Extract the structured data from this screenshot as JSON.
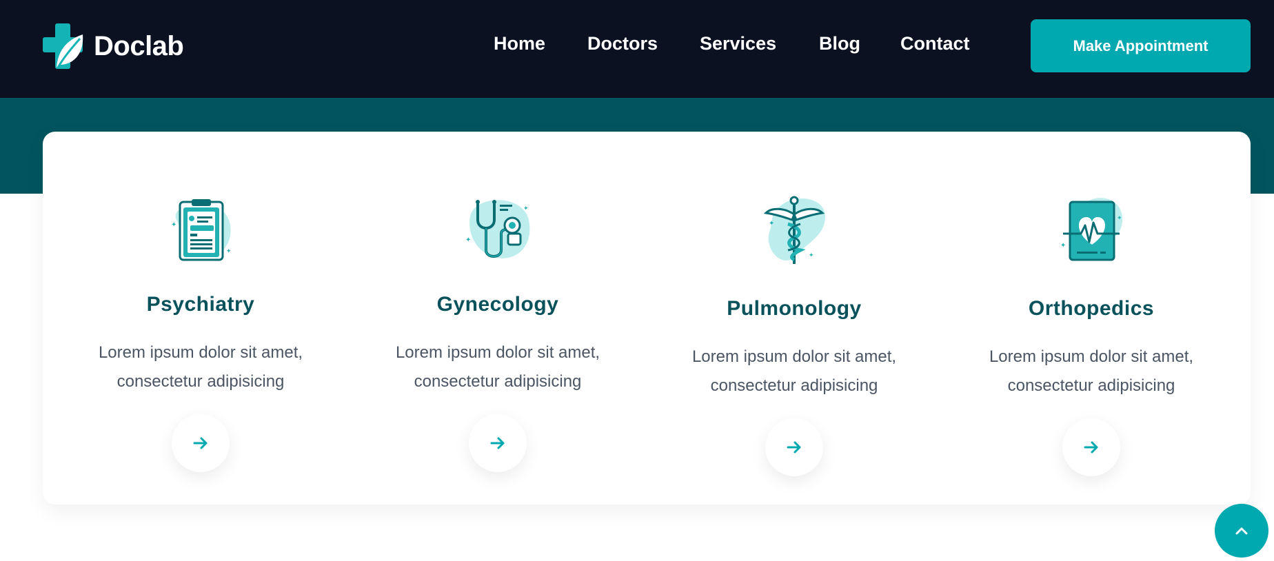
{
  "brand": {
    "name": "Doclab",
    "logo_icon": "cross-leaf-logo-icon"
  },
  "nav": {
    "items": [
      {
        "label": "Home"
      },
      {
        "label": "Doctors"
      },
      {
        "label": "Services"
      },
      {
        "label": "Blog"
      },
      {
        "label": "Contact"
      }
    ],
    "cta_label": "Make Appointment"
  },
  "services": [
    {
      "title": "Psychiatry",
      "desc_line1": "Lorem ipsum dolor sit amet,",
      "desc_line2": "consectetur adipisicing",
      "icon": "clipboard-icon"
    },
    {
      "title": "Gynecology",
      "desc_line1": "Lorem ipsum dolor sit amet,",
      "desc_line2": "consectetur adipisicing",
      "icon": "stethoscope-icon"
    },
    {
      "title": "Pulmonology",
      "desc_line1": "Lorem ipsum dolor sit amet,",
      "desc_line2": "consectetur adipisicing",
      "icon": "caduceus-icon"
    },
    {
      "title": "Orthopedics",
      "desc_line1": "Lorem ipsum dolor sit amet,",
      "desc_line2": "consectetur adipisicing",
      "icon": "heart-monitor-icon"
    }
  ],
  "colors": {
    "header_bg": "#0b1120",
    "band_bg": "#02555f",
    "accent": "#00a8b0",
    "title": "#0a525b",
    "text": "#4b5563"
  },
  "scroll_top_icon": "chevron-up-icon"
}
